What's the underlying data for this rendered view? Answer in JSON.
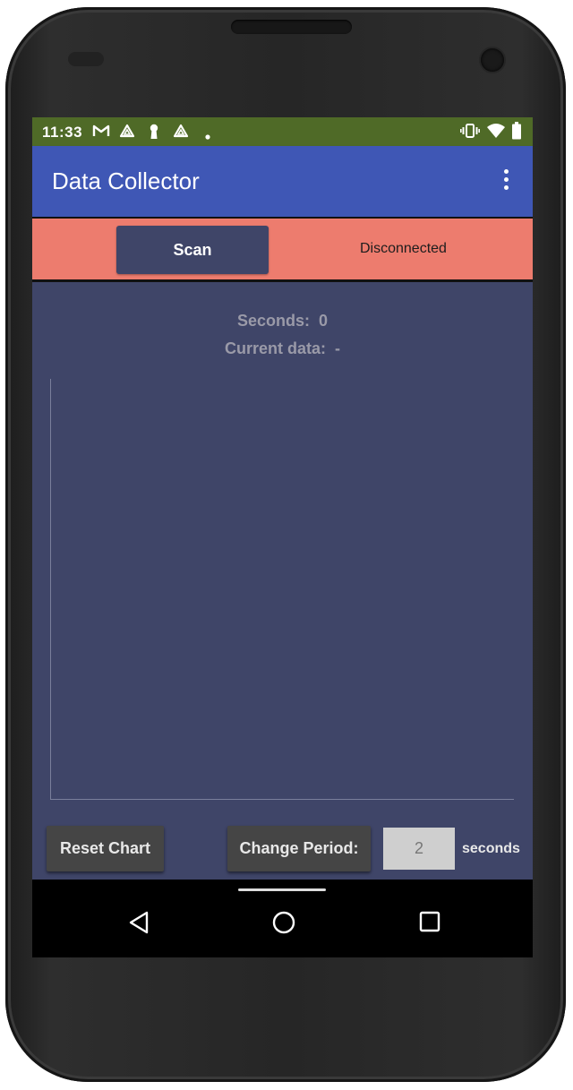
{
  "status_bar": {
    "time": "11:33",
    "notification_icons": [
      "gmail-icon",
      "drive-icon",
      "keyhole-icon",
      "drive-icon",
      "dot-icon"
    ],
    "system_icons": [
      "vibrate-icon",
      "wifi-icon",
      "battery-icon"
    ],
    "color": "#4f6a27"
  },
  "app_bar": {
    "title": "Data Collector",
    "overflow_icon": "more-vertical-icon",
    "color": "#3f57b5"
  },
  "connection": {
    "scan_label": "Scan",
    "status": "Disconnected",
    "color": "#ed7c6e"
  },
  "stats": {
    "seconds_label": "Seconds:",
    "seconds_value": "0",
    "data_label": "Current data:",
    "data_value": "-"
  },
  "chart_data": {
    "type": "line",
    "series": [],
    "title": "",
    "xlabel": "",
    "ylabel": "",
    "grid": false
  },
  "controls": {
    "reset_label": "Reset Chart",
    "change_period_label": "Change Period:",
    "period_value": "2",
    "period_unit": "seconds"
  },
  "nav_bar": {
    "icons": [
      "back-icon",
      "home-icon",
      "recents-icon"
    ]
  },
  "theme": {
    "content_bg": "#3f4568"
  }
}
